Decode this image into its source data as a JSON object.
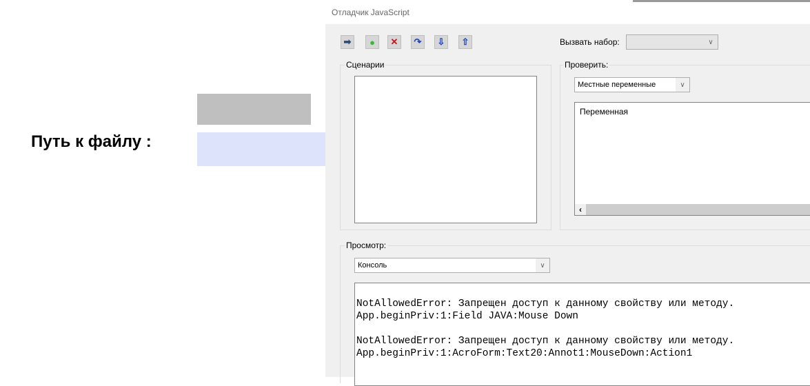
{
  "page": {
    "path_label": "Путь к файлу :"
  },
  "dialog": {
    "title": "Отладчик JavaScript",
    "toolbar": [
      {
        "name": "resume-icon",
        "glyph": "➡",
        "color": "#2b4a7a"
      },
      {
        "name": "breakpoint-icon",
        "glyph": "●",
        "color": "#3cb83c"
      },
      {
        "name": "stop-icon",
        "glyph": "✕",
        "color": "#d01010"
      },
      {
        "name": "step-over-icon",
        "glyph": "↷",
        "color": "#1a3fbf"
      },
      {
        "name": "step-into-icon",
        "glyph": "⇩",
        "color": "#1a3fbf"
      },
      {
        "name": "step-out-icon",
        "glyph": "⇧",
        "color": "#1a3fbf"
      }
    ],
    "call_stack_label": "Вызвать набор:",
    "call_stack_value": "",
    "scripts_label": "Сценарии",
    "inspect_label": "Проверить:",
    "inspect_select": "Местные переменные",
    "variable_header": "Переменная",
    "view_label": "Просмотр:",
    "view_select": "Консоль",
    "console_lines": [
      "NotAllowedError: Запрещен доступ к данному свойству или методу.",
      "App.beginPriv:1:Field JAVA:Mouse Down",
      "",
      "NotAllowedError: Запрещен доступ к данному свойству или методу.",
      "App.beginPriv:1:AcroForm:Text20:Annot1:MouseDown:Action1"
    ]
  }
}
